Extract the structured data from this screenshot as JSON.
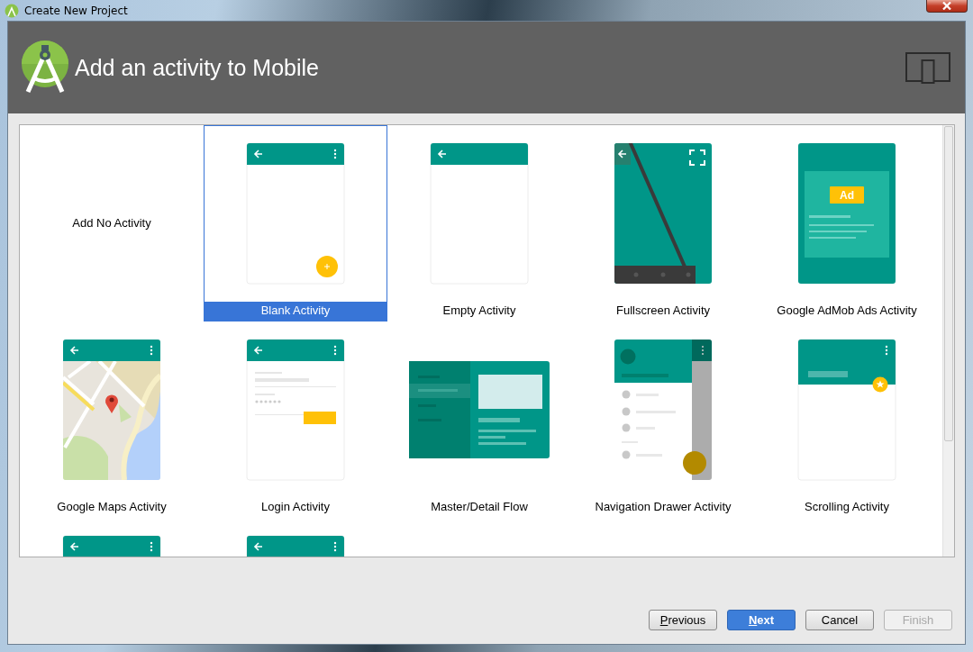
{
  "window": {
    "title": "Create New Project"
  },
  "header": {
    "title": "Add an activity to Mobile"
  },
  "templates": [
    {
      "kind": "none",
      "label": "Add No Activity",
      "selected": false
    },
    {
      "kind": "blank",
      "label": "Blank Activity",
      "selected": true
    },
    {
      "kind": "empty",
      "label": "Empty Activity",
      "selected": false
    },
    {
      "kind": "fullscreen",
      "label": "Fullscreen Activity",
      "selected": false
    },
    {
      "kind": "admob",
      "label": "Google AdMob Ads Activity",
      "badge": "Ad",
      "selected": false
    },
    {
      "kind": "maps",
      "label": "Google Maps Activity",
      "selected": false
    },
    {
      "kind": "login",
      "label": "Login Activity",
      "selected": false
    },
    {
      "kind": "masterdetail",
      "label": "Master/Detail Flow",
      "selected": false
    },
    {
      "kind": "navdrawer",
      "label": "Navigation Drawer Activity",
      "selected": false
    },
    {
      "kind": "scrolling",
      "label": "Scrolling Activity",
      "selected": false
    },
    {
      "kind": "toolbar",
      "selected": false
    },
    {
      "kind": "toolbar",
      "selected": false
    }
  ],
  "buttons": [
    {
      "label": "Previous",
      "mnemonic": true,
      "default": false,
      "disabled": false
    },
    {
      "label": "Next",
      "mnemonic": true,
      "default": true,
      "disabled": false
    },
    {
      "label": "Cancel",
      "mnemonic": false,
      "default": false,
      "disabled": false
    },
    {
      "label": "Finish",
      "mnemonic": false,
      "default": false,
      "disabled": true
    }
  ]
}
